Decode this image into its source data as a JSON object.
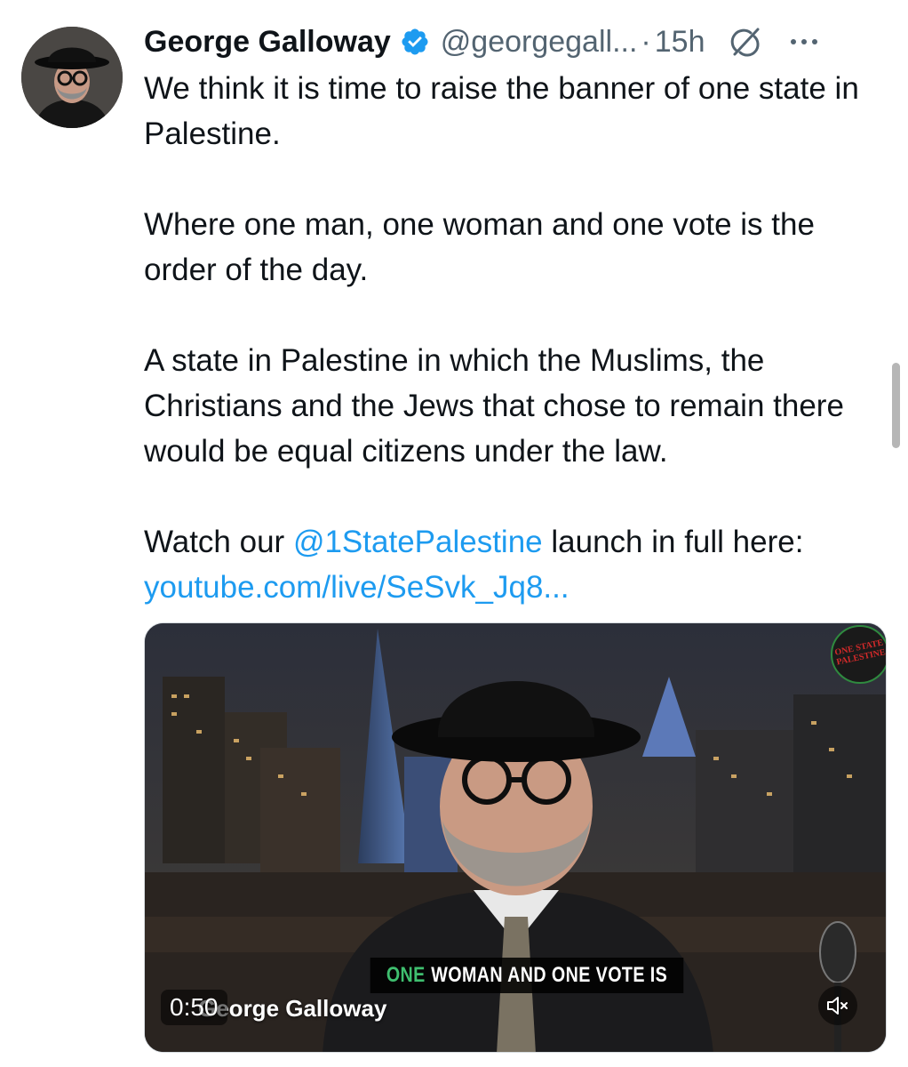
{
  "tweet": {
    "author_name": "George Galloway",
    "handle": "@georgegall...",
    "separator": "·",
    "time": "15h",
    "paragraphs": [
      "We think it is time to raise the banner of one state in Palestine.",
      "Where one man, one woman and one vote is the order of the day.",
      "A state in Palestine in which the Muslims, the Christians and the Jews that chose to remain there would be equal citizens under the law."
    ],
    "watch_prefix": "Watch our ",
    "mention": "@1StatePalestine",
    "watch_suffix": " launch in full here:",
    "url": "youtube.com/live/SeSvk_Jq8..."
  },
  "video": {
    "subtitle_highlight": "ONE",
    "subtitle_rest": "WOMAN AND ONE VOTE IS",
    "nameplate": "George Galloway",
    "duration": "0:50",
    "logo_text": "ONE STATE PALESTINE"
  },
  "icons": {
    "verified": "verified-badge-icon",
    "grok": "grok-icon",
    "more": "more-options-icon",
    "mute": "speaker-muted-icon"
  },
  "colors": {
    "text": "#0f1419",
    "secondary": "#536471",
    "link": "#1d9bf0",
    "verified": "#1d9bf0",
    "subtitle_highlight": "#3fbf6f"
  }
}
